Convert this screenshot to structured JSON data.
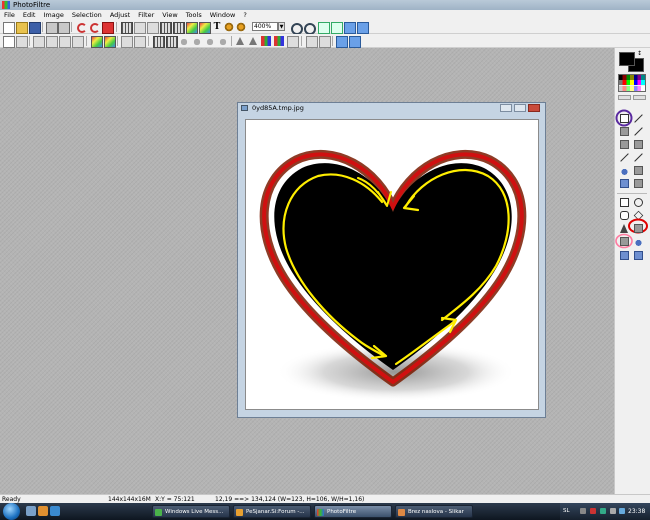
{
  "window": {
    "title": "PhotoFiltre"
  },
  "menu": [
    "File",
    "Edit",
    "Image",
    "Selection",
    "Adjust",
    "Filter",
    "View",
    "Tools",
    "Window",
    "?"
  ],
  "toolbar": {
    "zoom_value": "400%"
  },
  "image_window": {
    "title": "0yd85A.tmp.jpg"
  },
  "status": {
    "ready": "Ready",
    "image_size": "144x144x16M",
    "cursor": "X:Y = 75:121",
    "selection": "12,19 ==> 134,124 (W=123, H=106, W/H=1,16)"
  },
  "taskbar": {
    "items": [
      {
        "label": "Windows Live Mess...",
        "active": false
      },
      {
        "label": "PeSjanar.Si:Forum -...",
        "active": false
      },
      {
        "label": "PhotoFiltre",
        "active": true
      },
      {
        "label": "Brez naslova - Slikar",
        "active": false
      }
    ],
    "language": "SL",
    "clock": "23:38"
  },
  "colors": {
    "foreground": "#000000",
    "background": "#000000",
    "heart_fill": "#000000",
    "heart_outline": "#d01010",
    "heart_glow": "#7a1a00",
    "annotation_yellow": "#ffee00",
    "marker_purple": "#5a2aa0",
    "marker_red": "#e00000",
    "marker_pink": "#ff7aa0"
  },
  "icons": {
    "right_panel": [
      "selection-arrow-icon",
      "eyedropper-icon",
      "magic-wand-icon",
      "line-icon",
      "fill-bucket-icon",
      "spray-icon",
      "brush-icon",
      "pencil-icon",
      "blur-drop-icon",
      "smudge-icon",
      "stamp-icon",
      "rectangle-icon",
      "ellipse-icon",
      "rounded-rect-icon",
      "diamond-icon",
      "triangle-icon",
      "lasso-icon",
      "polygon-icon",
      "pattern-icon"
    ]
  }
}
